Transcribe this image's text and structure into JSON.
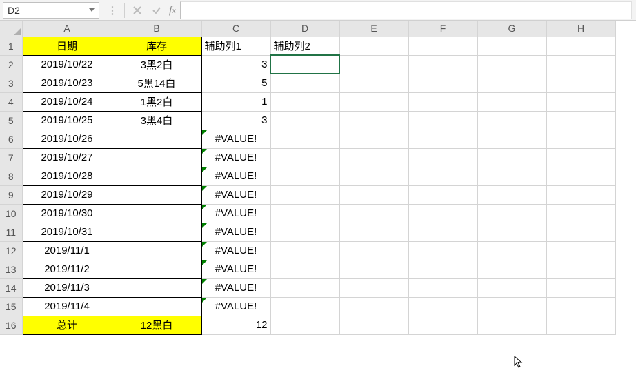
{
  "name_box": "D2",
  "formula": "",
  "columns": [
    "A",
    "B",
    "C",
    "D",
    "E",
    "F",
    "G",
    "H"
  ],
  "row_headers": [
    1,
    2,
    3,
    4,
    5,
    6,
    7,
    8,
    9,
    10,
    11,
    12,
    13,
    14,
    15,
    16
  ],
  "active_cell": "D2",
  "cells": {
    "A1": "日期",
    "B1": "库存",
    "C1": "辅助列1",
    "D1": "辅助列2",
    "A2": "2019/10/22",
    "B2": "3黑2白",
    "C2": "3",
    "A3": "2019/10/23",
    "B3": "5黑14白",
    "C3": "5",
    "A4": "2019/10/24",
    "B4": "1黑2白",
    "C4": "1",
    "A5": "2019/10/25",
    "B5": "3黑4白",
    "C5": "3",
    "A6": "2019/10/26",
    "B6": "",
    "C6": "#VALUE!",
    "A7": "2019/10/27",
    "B7": "",
    "C7": "#VALUE!",
    "A8": "2019/10/28",
    "B8": "",
    "C8": "#VALUE!",
    "A9": "2019/10/29",
    "B9": "",
    "C9": "#VALUE!",
    "A10": "2019/10/30",
    "B10": "",
    "C10": "#VALUE!",
    "A11": "2019/10/31",
    "B11": "",
    "C11": "#VALUE!",
    "A12": "2019/11/1",
    "B12": "",
    "C12": "#VALUE!",
    "A13": "2019/11/2",
    "B13": "",
    "C13": "#VALUE!",
    "A14": "2019/11/3",
    "B14": "",
    "C14": "#VALUE!",
    "A15": "2019/11/4",
    "B15": "",
    "C15": "#VALUE!",
    "A16": "总计",
    "B16": "12黑白",
    "C16": "12"
  },
  "highlight_cells": [
    "A1",
    "B1",
    "A16",
    "B16"
  ],
  "bordered_cols": [
    "A",
    "B"
  ],
  "error_cells": [
    "C6",
    "C7",
    "C8",
    "C9",
    "C10",
    "C11",
    "C12",
    "C13",
    "C14",
    "C15"
  ],
  "right_align_cells": [
    "C2",
    "C3",
    "C4",
    "C5",
    "C16"
  ],
  "left_align_cells": [
    "C1",
    "D1"
  ]
}
